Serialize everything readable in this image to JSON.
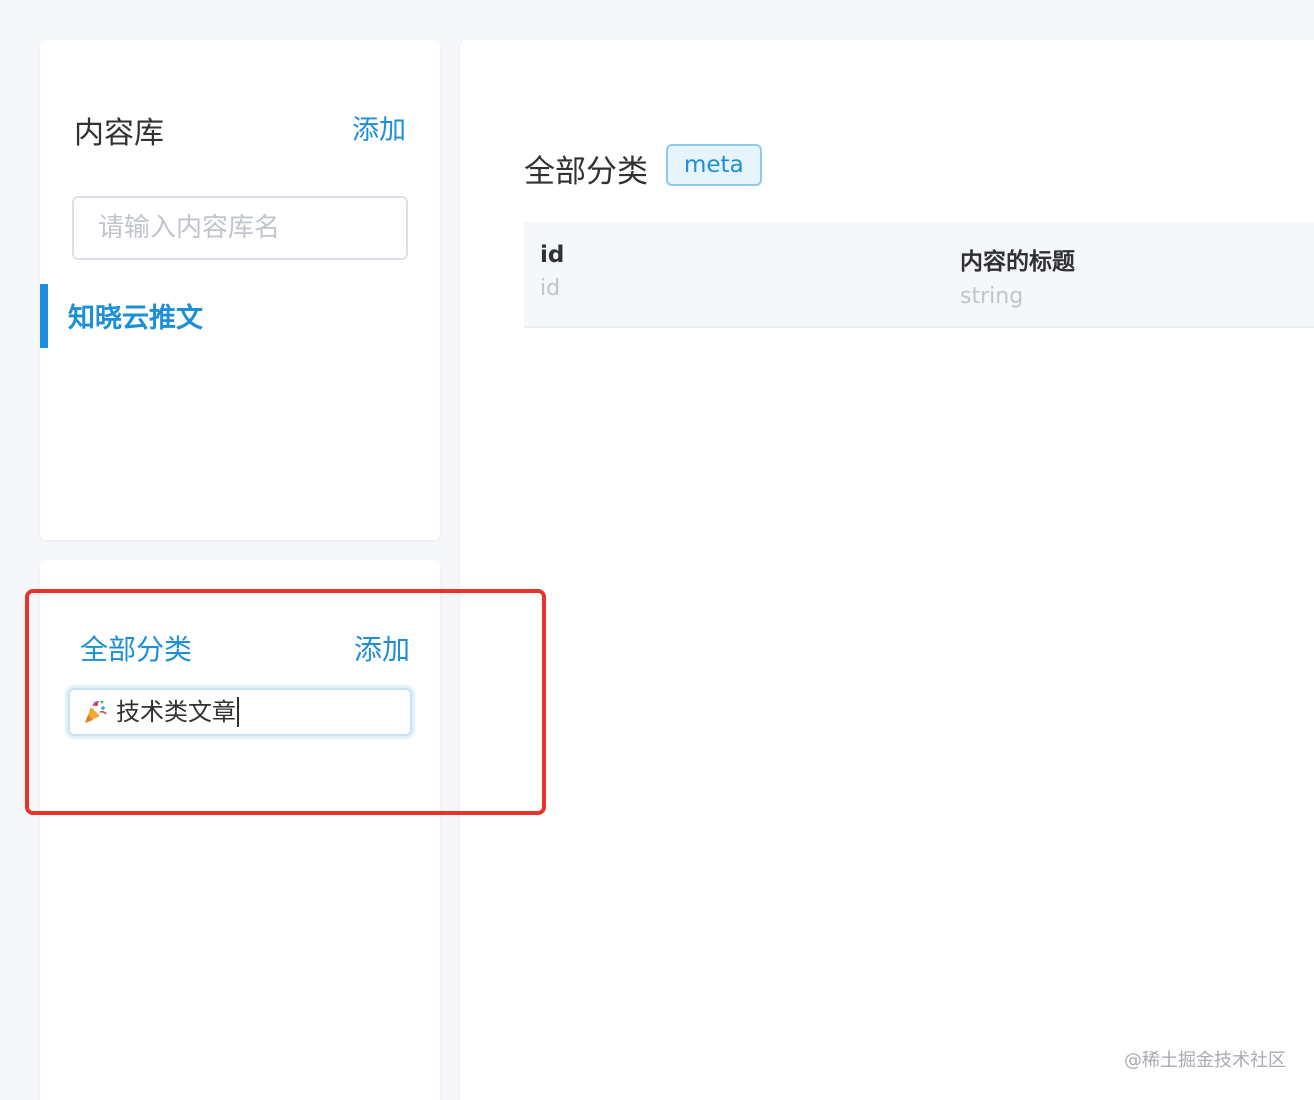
{
  "library": {
    "title": "内容库",
    "add_label": "添加",
    "search_placeholder": "请输入内容库名",
    "items": [
      {
        "label": "知晓云推文",
        "active": true
      }
    ]
  },
  "categories": {
    "title": "全部分类",
    "add_label": "添加",
    "new_input_value": "技术类文章"
  },
  "main": {
    "title": "全部分类",
    "tag": "meta",
    "fields": [
      {
        "name": "id",
        "type": "id"
      },
      {
        "name": "内容的标题",
        "type": "string"
      }
    ]
  },
  "watermark": "@稀土掘金技术社区",
  "colors": {
    "accent": "#1b8fd8",
    "highlight": "#e8322a",
    "background": "#f5f7fb"
  },
  "icons": {
    "input_icon": "party-popper-icon"
  }
}
